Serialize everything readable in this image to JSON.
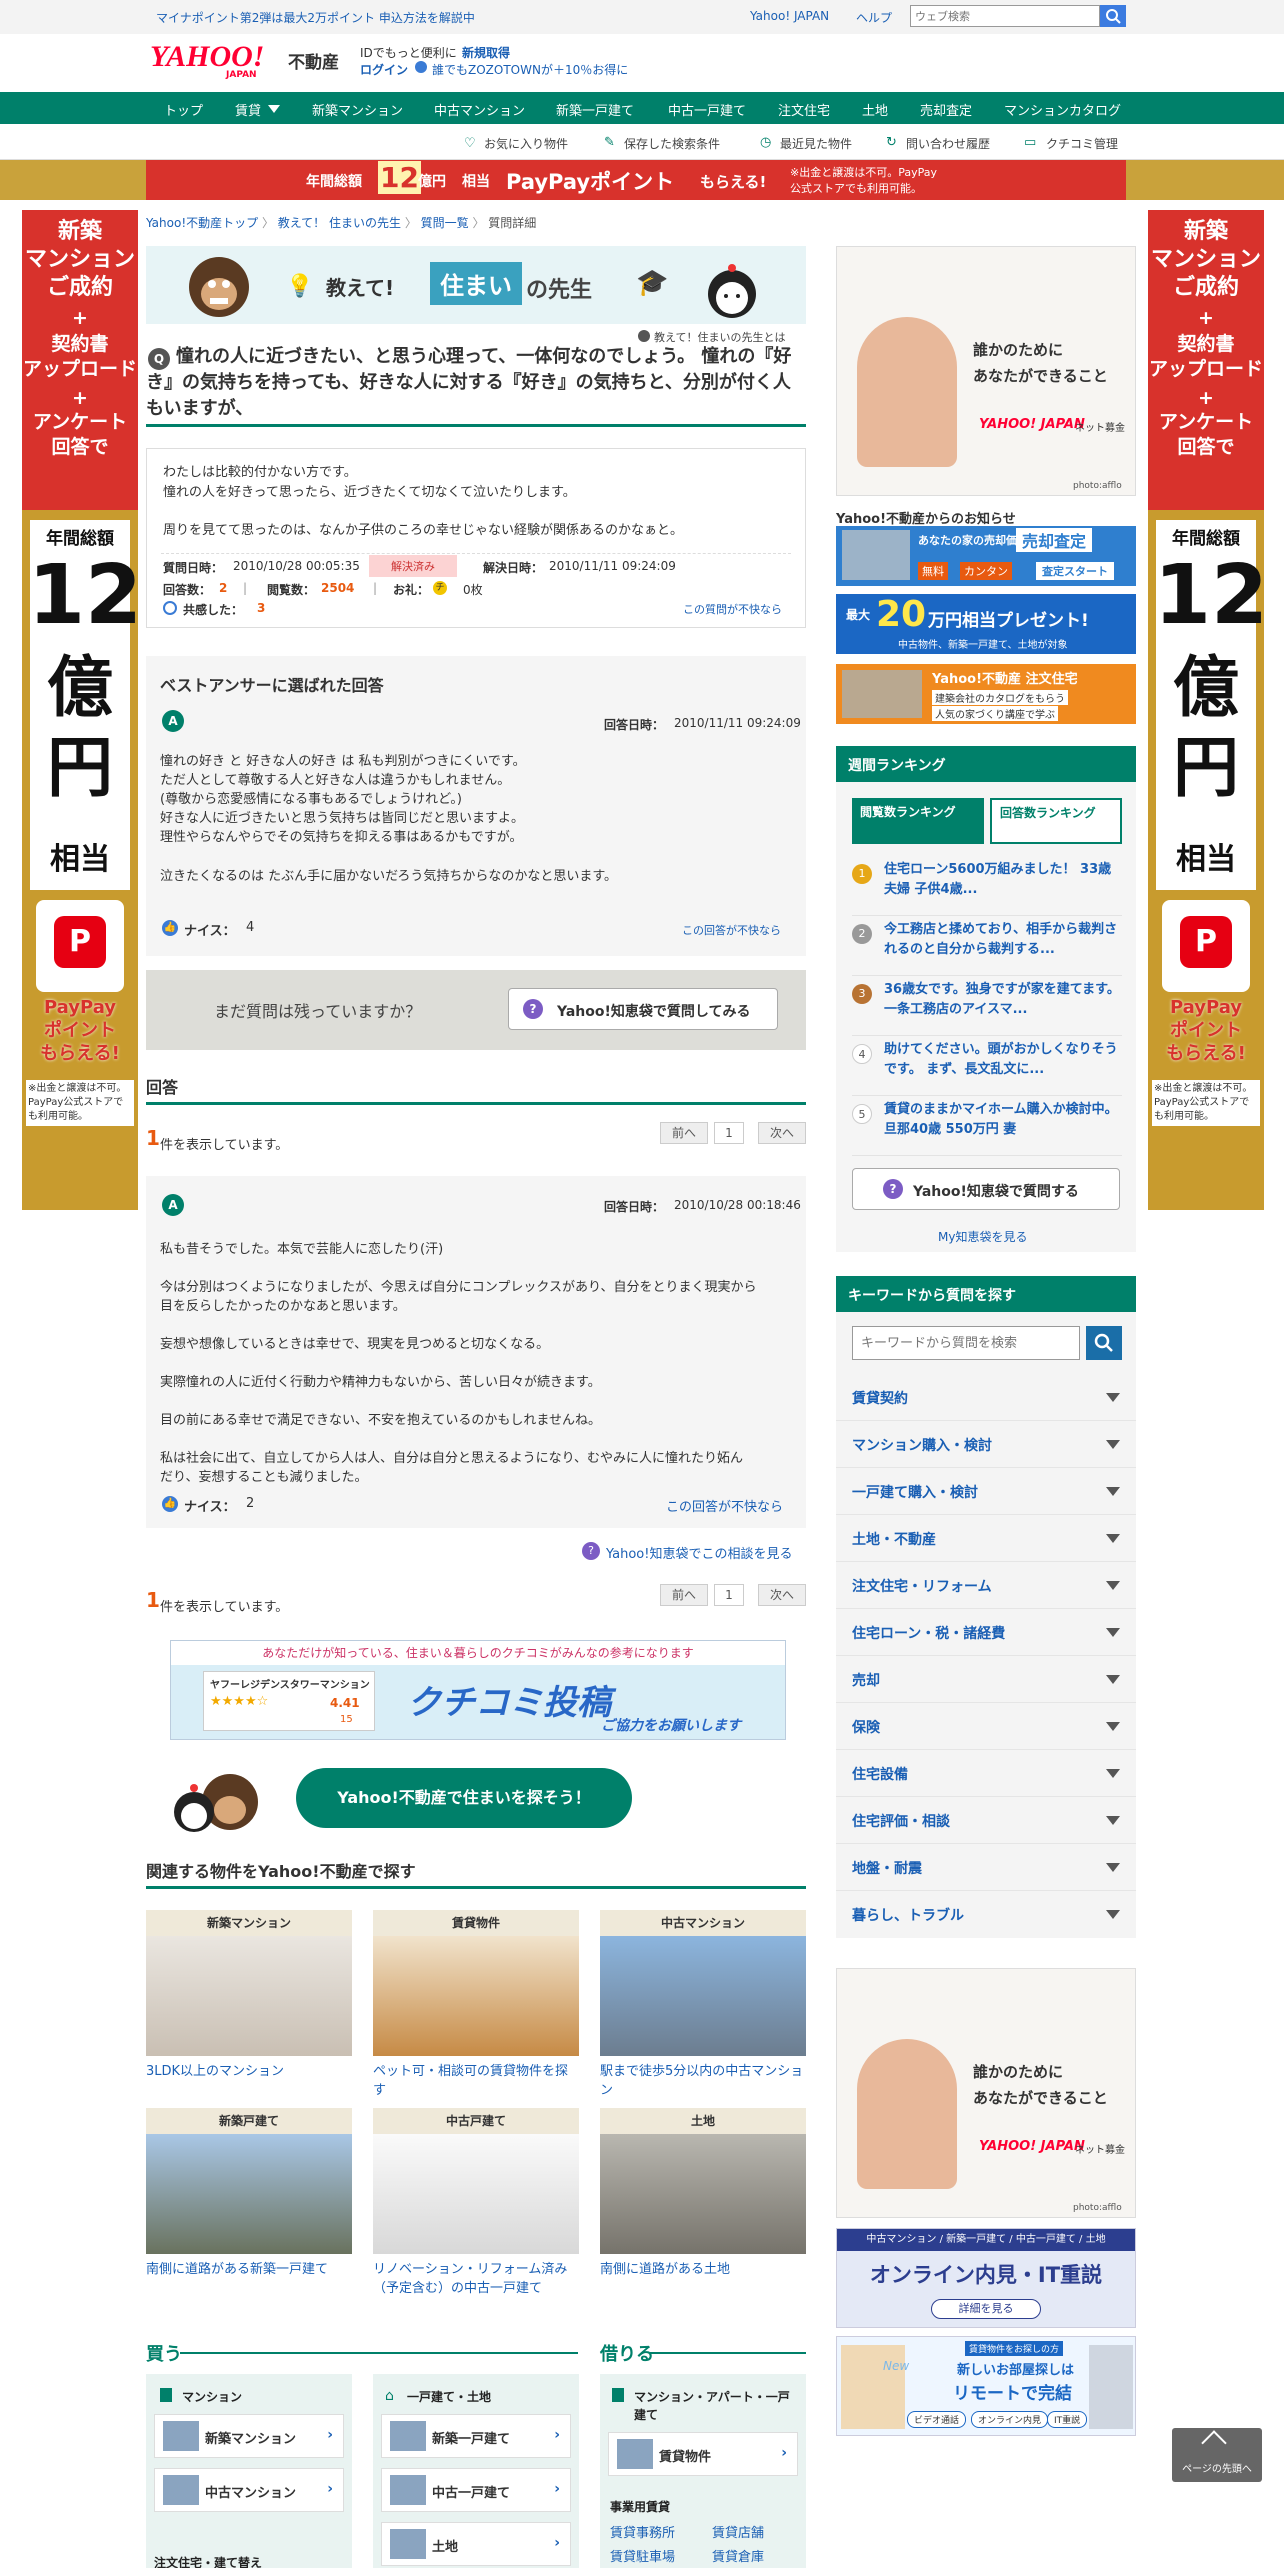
{
  "topbar": {
    "promo": "マイナポイント第2弾は最大2万ポイント 申込方法を解説中",
    "yahoo_japan": "Yahoo! JAPAN",
    "help": "ヘルプ",
    "search_placeholder": "ウェブ検索"
  },
  "header": {
    "logo": "YAHOO!",
    "logo_sub": "JAPAN",
    "logo_product": "不動産",
    "id_text": "IDでもっと便利に",
    "register": "新規取得",
    "login": "ログイン",
    "zozo": "誰でもZOZOTOWNが＋10％お得に"
  },
  "gnav": [
    "トップ",
    "賃貸",
    "新築マンション",
    "中古マンション",
    "新築一戸建て",
    "中古一戸建て",
    "注文住宅",
    "土地",
    "売却査定",
    "マンションカタログ"
  ],
  "subnav": [
    "お気に入り物件",
    "保存した検索条件",
    "最近見た物件",
    "問い合わせ履歴",
    "クチコミ管理"
  ],
  "banner": {
    "pre": "年間総額",
    "num": "12",
    "unit": "億円",
    "post": "相当",
    "pp": "PayPayポイント",
    "suffix": "もらえる!",
    "note1": "※出金と譲渡は不可。PayPay",
    "note2": "公式ストアでも利用可能。"
  },
  "side_ad": {
    "line1": "新築",
    "line2": "マンション",
    "line3": "ご成約",
    "plus": "+",
    "line4": "契約書",
    "line5": "アップロード",
    "line6": "アンケート",
    "line7": "回答で",
    "total": "年間総額",
    "n1": "12",
    "n2": "億",
    "n3": "円",
    "soutou": "相当",
    "pp1": "PayPay",
    "pp2": "ポイント",
    "pp3": "もらえる!",
    "note": "※出金と譲渡は不可。PayPay公式ストアでも利用可能。"
  },
  "breadcrumb": [
    "Yahoo!不動産トップ",
    "教えて！ 住まいの先生",
    "質問一覧",
    "質問詳細"
  ],
  "sensei": {
    "title1": "教えて!",
    "title2": "住まい",
    "title3": "の先生",
    "about": "教えて！住まいの先生とは"
  },
  "question": {
    "badge": "Q",
    "title": "憧れの人に近づきたい、と思う心理って、一体何なのでしょう。 憧れの『好き』の気持ちを持っても、好きな人に対する『好き』の気持ちと、分別が付く人もいますが、",
    "body1": "わたしは比較的付かない方です。",
    "body2": "憧れの人を好きって思ったら、近づきたくて切なくて泣いたりします。",
    "body3": "周りを見てて思ったのは、なんか子供のころの幸せじゃない経験が関係あるのかなぁと。",
    "date_label": "質問日時：",
    "date": "2010/10/28 00:05:35",
    "status": "解決済み",
    "solved_label": "解決日時：",
    "solved": "2010/11/11 09:24:09",
    "answers_label": "回答数：",
    "answers": "2",
    "views_label": "閲覧数：",
    "views": "2504",
    "reward_label": "お礼：",
    "reward": "0枚",
    "empathy_label": "共感した：",
    "empathy": "3",
    "report": "この質問が不快なら"
  },
  "best": {
    "heading": "ベストアンサーに選ばれた回答",
    "date_label": "回答日時：",
    "date": "2010/11/11 09:24:09",
    "l1": "憧れの好き と 好きな人の好き は 私も判別がつきにくいです。",
    "l2": "ただ人として尊敬する人と好きな人は違うかもしれません。",
    "l3": "(尊敬から恋愛感情になる事もあるでしょうけれど。)",
    "l4": "好きな人に近づきたいと思う気持ちは皆同じだと思いますよ。",
    "l5": "理性やらなんやらでその気持ちを抑える事はあるかもですが。",
    "l6": "泣きたくなるのは たぶん手に届かないだろう気持ちからなのかなと思います。",
    "nice_label": "ナイス：",
    "nice": "4",
    "report": "この回答が不快なら"
  },
  "ask": {
    "text": "まだ質問は残っていますか？",
    "button": "Yahoo!知恵袋で質問してみる"
  },
  "answers": {
    "heading": "回答",
    "count": "1",
    "count_text": "件を表示しています。",
    "prev": "前へ",
    "page": "1",
    "next": "次へ"
  },
  "answer1": {
    "date_label": "回答日時：",
    "date": "2010/10/28 00:18:46",
    "p1": "私も昔そうでした。本気で芸能人に恋したり(汗)",
    "p2a": "今は分別はつくようになりましたが、今思えば自分にコンプレックスがあり、自分をとりまく現実から",
    "p2b": "目を反らしたかったのかなあと思います。",
    "p3": "妄想や想像しているときは幸せで、現実を見つめると切なくなる。",
    "p4": "実際憧れの人に近付く行動力や精神力もないから、苦しい日々が続きます。",
    "p5": "目の前にある幸せで満足できない、不安を抱えているのかもしれませんね。",
    "p6a": "私は社会に出て、自立してから人は人、自分は自分と思えるようになり、むやみに人に憧れたり妬ん",
    "p6b": "だり、妄想することも減りました。",
    "nice_label": "ナイス：",
    "nice": "2",
    "report": "この回答が不快なら"
  },
  "consult": "Yahoo!知恵袋でこの相談を見る",
  "kuchikomi": {
    "top": "あなただけが知っている、住まい＆暮らしのクチコミがみんなの参考になります",
    "name": "ヤフーレジデンスタワーマンション",
    "rating": "4.41",
    "count": "15",
    "title": "クチコミ投稿",
    "sub": "ご協力をお願いします"
  },
  "search_bubble": "Yahoo!不動産で住まいを探そう！",
  "related": {
    "heading": "関連する物件をYahoo!不動産で探す",
    "items": [
      {
        "cat": "新築マンション",
        "text": "3LDK以上のマンション"
      },
      {
        "cat": "賃貸物件",
        "text": "ペット可・相談可の賃貸物件を探す"
      },
      {
        "cat": "中古マンション",
        "text": "駅まで徒歩5分以内の中古マンション"
      },
      {
        "cat": "新築戸建て",
        "text": "南側に道路がある新築一戸建て"
      },
      {
        "cat": "中古戸建て",
        "text": "リノベーション・リフォーム済み（予定含む）の中古一戸建て"
      },
      {
        "cat": "土地",
        "text": "南側に道路がある土地"
      }
    ]
  },
  "buy": {
    "heading": "買う",
    "mansion": "マンション",
    "new_mansion": "新築マンション",
    "used_mansion": "中古マンション",
    "house": "一戸建て・土地",
    "new_house": "新築一戸建て",
    "used_house": "中古一戸建て",
    "land": "土地",
    "custom": "注文住宅・建て替え"
  },
  "rent": {
    "heading": "借りる",
    "cat": "マンション・アパート・一戸建て",
    "chintai": "賃貸物件",
    "biz": "事業用賃貸",
    "office": "賃貸事務所",
    "shop": "賃貸店舗",
    "parking": "賃貸駐車場",
    "warehouse": "賃貸倉庫"
  },
  "right_ad": {
    "text1": "誰かのために",
    "text2": "あなたができること",
    "brand": "YAHOO! JAPAN",
    "bokin": "ネット募金",
    "credit": "photo:afflo"
  },
  "notice": {
    "heading": "Yahoo!不動産からのお知らせ",
    "b1a": "あなたの家の売却価格は？",
    "b1b": "売却査定",
    "b1c": "無料",
    "b1d": "カンタン",
    "b1e": "査定スタート",
    "b2a": "最大",
    "b2b": "20",
    "b2c": "万円相当プレゼント!",
    "b2d": "中古物件、新築一戸建て、土地が対象",
    "b3a": "Yahoo!不動産 注文住宅",
    "b3b": "建築会社のカタログをもらう",
    "b3c": "人気の家づくり講座で学ぶ"
  },
  "ranking": {
    "heading": "週間ランキング",
    "tab1": "閲覧数ランキング",
    "tab2": "回答数ランキング",
    "items": [
      "住宅ローン5600万組みました！ 33歳夫婦 子供4歳...",
      "今工務店と揉めており、相手から裁判されるのと自分から裁判する...",
      "36歳女です。独身ですが家を建てます。一条工務店のアイスマ...",
      "助けてください。頭がおかしくなりそうです。 まず、長文乱文に...",
      "賃貸のままかマイホーム購入か検討中。旦那40歳 550万円 妻"
    ],
    "ask_button": "Yahoo!知恵袋で質問する",
    "my": "My知恵袋を見る"
  },
  "keyword": {
    "heading": "キーワードから質問を探す",
    "placeholder": "キーワードから質問を検索",
    "items": [
      "賃貸契約",
      "マンション購入・検討",
      "一戸建て購入・検討",
      "土地・不動産",
      "注文住宅・リフォーム",
      "住宅ローン・税・諸経費",
      "売却",
      "保険",
      "住宅設備",
      "住宅評価・相談",
      "地盤・耐震",
      "暮らし、トラブル"
    ]
  },
  "bottom_ads": {
    "ad2a": "中古マンション / 新築一戸建て / 中古一戸建て / 土地",
    "ad2b": "オンライン内見・IT重説",
    "ad2c": "詳細を見る",
    "ad3a": "賃貸物件をお探しの方",
    "ad3b": "新しいお部屋探しは",
    "ad3c": "リモートで完結",
    "ad3d": "New",
    "ad3e": "ビデオ通話",
    "ad3f": "オンライン内見",
    "ad3g": "IT重説"
  },
  "pagetop": "ページの先頭へ",
  "colors": {
    "teal": "#00806a",
    "link": "#1a5fb4",
    "orange": "#e85a10",
    "red": "#d8322c"
  }
}
